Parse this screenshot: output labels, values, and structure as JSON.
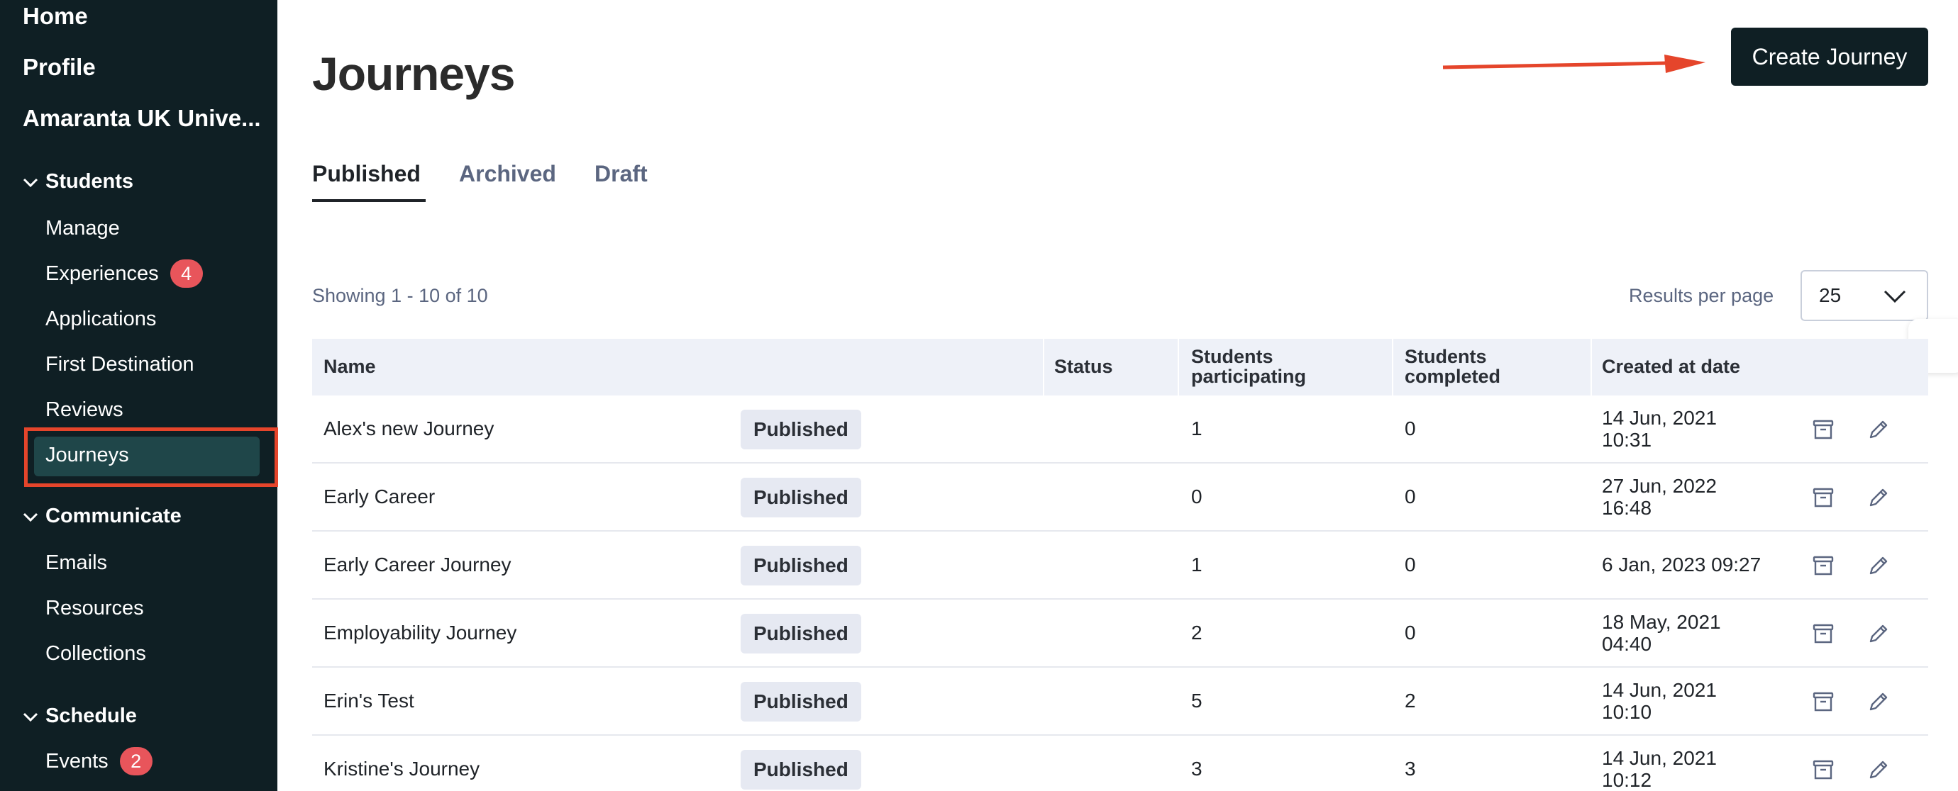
{
  "sidebar": {
    "home": "Home",
    "profile": "Profile",
    "org": "Amaranta UK Unive...",
    "students": {
      "label": "Students",
      "items": [
        {
          "label": "Manage"
        },
        {
          "label": "Experiences",
          "badge": "4"
        },
        {
          "label": "Applications"
        },
        {
          "label": "First Destination"
        },
        {
          "label": "Reviews"
        },
        {
          "label": "Journeys",
          "active": true
        }
      ]
    },
    "communicate": {
      "label": "Communicate",
      "items": [
        {
          "label": "Emails"
        },
        {
          "label": "Resources"
        },
        {
          "label": "Collections"
        }
      ]
    },
    "schedule": {
      "label": "Schedule",
      "items": [
        {
          "label": "Events",
          "badge": "2"
        }
      ]
    }
  },
  "header": {
    "title": "Journeys",
    "create_label": "Create Journey"
  },
  "tabs": [
    {
      "label": "Published",
      "active": true
    },
    {
      "label": "Archived"
    },
    {
      "label": "Draft"
    }
  ],
  "pagination": {
    "showing": "Showing 1 - 10 of 10",
    "rpp_label": "Results per page",
    "rpp_value": "25"
  },
  "table": {
    "columns": [
      "Name",
      "Status",
      "Students participating",
      "Students completed",
      "Created at date"
    ],
    "rows": [
      {
        "name": "Alex's new Journey",
        "status": "Published",
        "participating": "1",
        "completed": "0",
        "created": "14 Jun, 2021 10:31"
      },
      {
        "name": "Early Career",
        "status": "Published",
        "participating": "0",
        "completed": "0",
        "created": "27 Jun, 2022 16:48"
      },
      {
        "name": "Early Career Journey",
        "status": "Published",
        "participating": "1",
        "completed": "0",
        "created": "6 Jan, 2023 09:27"
      },
      {
        "name": "Employability Journey",
        "status": "Published",
        "participating": "2",
        "completed": "0",
        "created": "18 May, 2021 04:40"
      },
      {
        "name": "Erin's Test",
        "status": "Published",
        "participating": "5",
        "completed": "2",
        "created": "14 Jun, 2021 10:10"
      },
      {
        "name": "Kristine's Journey",
        "status": "Published",
        "participating": "3",
        "completed": "3",
        "created": "14 Jun, 2021 10:12"
      }
    ]
  },
  "colors": {
    "sidebar_bg": "#0f1f24",
    "active_bg": "#1f4649",
    "badge": "#e8555b",
    "annotation": "#e5452b",
    "primary_button": "#0f1f24"
  }
}
